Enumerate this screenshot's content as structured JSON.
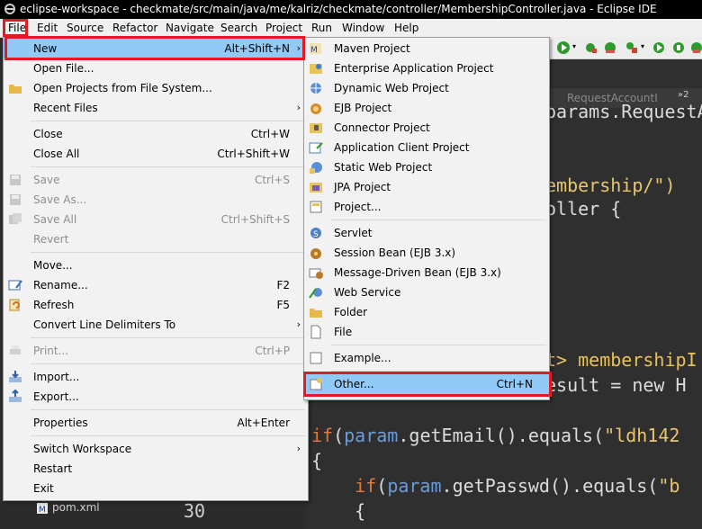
{
  "window": {
    "title": "eclipse-workspace - checkmate/src/main/java/me/kalriz/checkmate/controller/MembershipController.java - Eclipse IDE"
  },
  "menubar": [
    "File",
    "Edit",
    "Source",
    "Refactor",
    "Navigate",
    "Search",
    "Project",
    "Run",
    "Window",
    "Help"
  ],
  "editor": {
    "tab_label": "RequestAccountI",
    "tab_overflow": "»2",
    "code_lines": [
      "params.RequestA",
      "embership/\")",
      "oller {",
      "t> membershipI",
      "esult = new H",
      "if(param.getEmail().equals(\"ldh142",
      "{",
      "    if(param.getPasswd().equals(\"b",
      "    {",
      "30"
    ]
  },
  "project_explorer": {
    "item": "pom.xml"
  },
  "file_menu": {
    "items": [
      {
        "label": "New",
        "accel": "Alt+Shift+N",
        "submenu": true,
        "highlighted": true
      },
      {
        "label": "Open File...",
        "accel": "",
        "submenu": false
      },
      {
        "label": "Open Projects from File System...",
        "accel": "",
        "submenu": false
      },
      {
        "label": "Recent Files",
        "accel": "",
        "submenu": true
      },
      {
        "label": "Close",
        "accel": "Ctrl+W"
      },
      {
        "label": "Close All",
        "accel": "Ctrl+Shift+W"
      },
      {
        "label": "Save",
        "accel": "Ctrl+S",
        "disabled": true
      },
      {
        "label": "Save As...",
        "accel": "",
        "disabled": true
      },
      {
        "label": "Save All",
        "accel": "Ctrl+Shift+S",
        "disabled": true
      },
      {
        "label": "Revert",
        "accel": "",
        "disabled": true
      },
      {
        "label": "Move...",
        "accel": ""
      },
      {
        "label": "Rename...",
        "accel": "F2"
      },
      {
        "label": "Refresh",
        "accel": "F5"
      },
      {
        "label": "Convert Line Delimiters To",
        "accel": "",
        "submenu": true
      },
      {
        "label": "Print...",
        "accel": "Ctrl+P",
        "disabled": true
      },
      {
        "label": "Import...",
        "accel": ""
      },
      {
        "label": "Export...",
        "accel": ""
      },
      {
        "label": "Properties",
        "accel": "Alt+Enter"
      },
      {
        "label": "Switch Workspace",
        "accel": "",
        "submenu": true
      },
      {
        "label": "Restart",
        "accel": ""
      },
      {
        "label": "Exit",
        "accel": ""
      }
    ]
  },
  "new_menu": {
    "items": [
      {
        "label": "Maven Project",
        "icon": "maven-project-icon"
      },
      {
        "label": "Enterprise Application Project",
        "icon": "ear-project-icon"
      },
      {
        "label": "Dynamic Web Project",
        "icon": "web-project-icon"
      },
      {
        "label": "EJB Project",
        "icon": "ejb-project-icon"
      },
      {
        "label": "Connector Project",
        "icon": "connector-project-icon"
      },
      {
        "label": "Application Client Project",
        "icon": "app-client-icon"
      },
      {
        "label": "Static Web Project",
        "icon": "static-web-icon"
      },
      {
        "label": "JPA Project",
        "icon": "jpa-project-icon"
      },
      {
        "label": "Project...",
        "icon": "project-icon"
      },
      {
        "label": "Servlet",
        "icon": "servlet-icon"
      },
      {
        "label": "Session Bean (EJB 3.x)",
        "icon": "session-bean-icon"
      },
      {
        "label": "Message-Driven Bean (EJB 3.x)",
        "icon": "mdb-icon"
      },
      {
        "label": "Web Service",
        "icon": "web-service-icon"
      },
      {
        "label": "Folder",
        "icon": "folder-icon"
      },
      {
        "label": "File",
        "icon": "file-icon"
      },
      {
        "label": "Example...",
        "icon": "example-icon"
      },
      {
        "label": "Other...",
        "accel": "Ctrl+N",
        "icon": "other-wizard-icon",
        "highlighted": true
      }
    ]
  },
  "colors": {
    "highlight": "#91c9f7",
    "annotation_box": "#e11b22",
    "keyword": "#e07a3a",
    "string": "#e7c66f",
    "field": "#6d9bd8"
  }
}
